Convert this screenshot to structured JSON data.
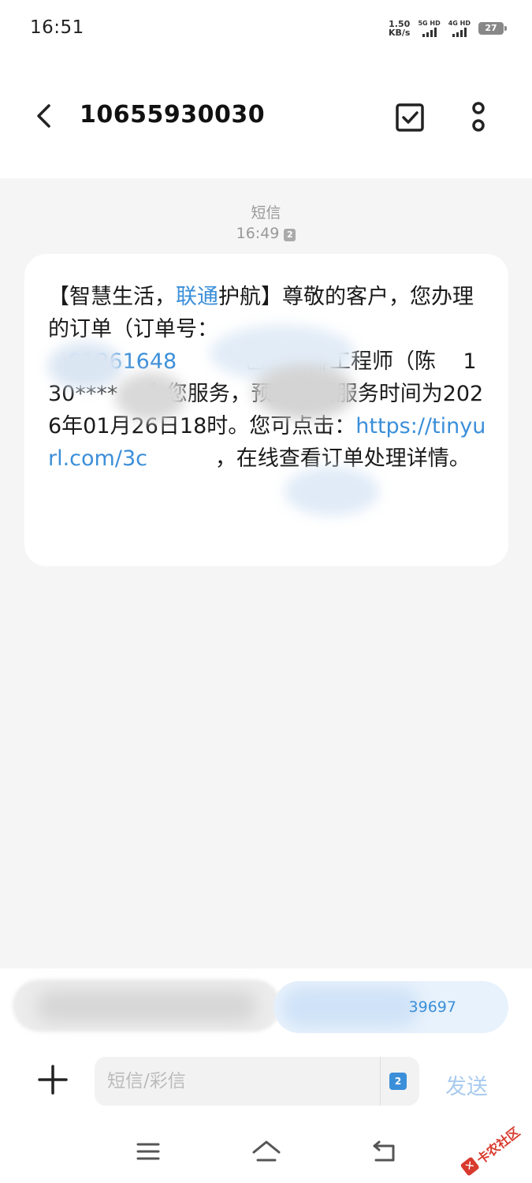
{
  "status_bar": {
    "time": "16:51",
    "net_speed_value": "1.50",
    "net_speed_unit": "KB/s",
    "sim1_label": "5G HD",
    "sim2_label": "4G HD",
    "battery": "27"
  },
  "header": {
    "contact_number": "10655930030",
    "icons": {
      "back": "chevron-left-icon",
      "select": "checkbox-icon",
      "more": "vertical-dots-icon"
    }
  },
  "conversation": {
    "message_type": "短信",
    "message_time": "16:49",
    "sim_badge": "2",
    "message": {
      "seg1": "【智慧生活，",
      "seg1_link": "联通",
      "seg2": "护航】尊敬的客户，您办理的订单（订单号：",
      "order_visible": "01261648",
      "seg3": "已经安排工程师（陈",
      "seg3b": "130****",
      "seg4": "为您服务，预约上门服务时间为2026年01月26日18时。您可点击：",
      "url_visible": "https://tinyurl.com/3c",
      "seg5": "，在线查看订单处理详情。"
    }
  },
  "quick_reply": {
    "right_visible_text": "39697"
  },
  "composer": {
    "placeholder": "短信/彩信",
    "sim_badge": "2",
    "send_label": "发送"
  },
  "nav": {
    "icons": [
      "menu-icon",
      "home-icon",
      "back-nav-icon"
    ]
  },
  "watermark": {
    "text": "卡农社区"
  },
  "colors": {
    "accent": "#3b8fd9",
    "background": "#f5f5f5",
    "bubble": "#ffffff",
    "send_disabled": "#a9cbee",
    "watermark": "#d83a2e"
  }
}
